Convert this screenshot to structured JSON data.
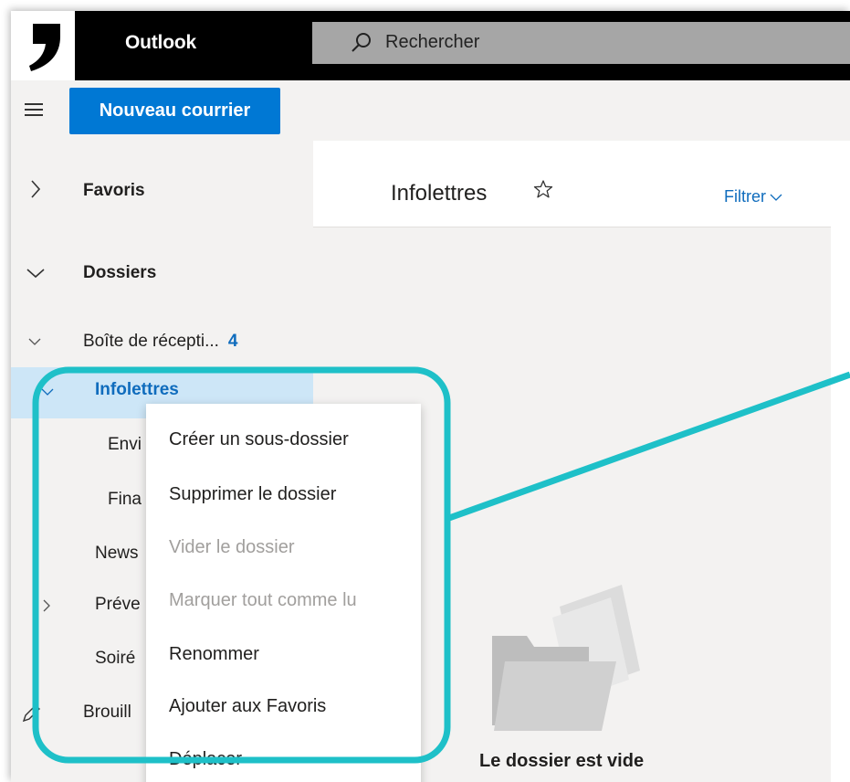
{
  "app": {
    "title": "Outlook"
  },
  "search": {
    "placeholder": "Rechercher"
  },
  "toolbar": {
    "new_mail_label": "Nouveau courrier"
  },
  "sidebar": {
    "favorites_label": "Favoris",
    "folders_label": "Dossiers",
    "inbox": {
      "label": "Boîte de récepti...",
      "count": "4"
    },
    "items": [
      {
        "label": "Infolettres",
        "selected": true
      },
      {
        "label": "Envi"
      },
      {
        "label": "Fina"
      },
      {
        "label": "News"
      },
      {
        "label": "Préve"
      },
      {
        "label": "Soiré"
      },
      {
        "label": "Brouill"
      }
    ]
  },
  "list": {
    "folder_title": "Infolettres",
    "filter_label": "Filtrer",
    "empty_text": "Le dossier est vide"
  },
  "context_menu": {
    "items": [
      {
        "label": "Créer un sous-dossier",
        "enabled": true
      },
      {
        "label": "Supprimer le dossier",
        "enabled": true
      },
      {
        "label": "Vider le dossier",
        "enabled": false
      },
      {
        "label": "Marquer tout comme lu",
        "enabled": false
      },
      {
        "label": "Renommer",
        "enabled": true
      },
      {
        "label": "Ajouter aux Favoris",
        "enabled": true
      },
      {
        "label": "Déplacer",
        "enabled": true
      }
    ]
  },
  "colors": {
    "accent": "#0078d4",
    "selected_bg": "#cde6f7",
    "callout": "#1ec0c8",
    "disabled_text": "#a19f9d"
  },
  "icons": [
    "logo-icon",
    "search-icon",
    "hamburger-icon",
    "chevron-right-icon",
    "chevron-down-icon",
    "star-icon",
    "chevron-down-small-icon",
    "pencil-icon",
    "empty-folder-illustration"
  ]
}
